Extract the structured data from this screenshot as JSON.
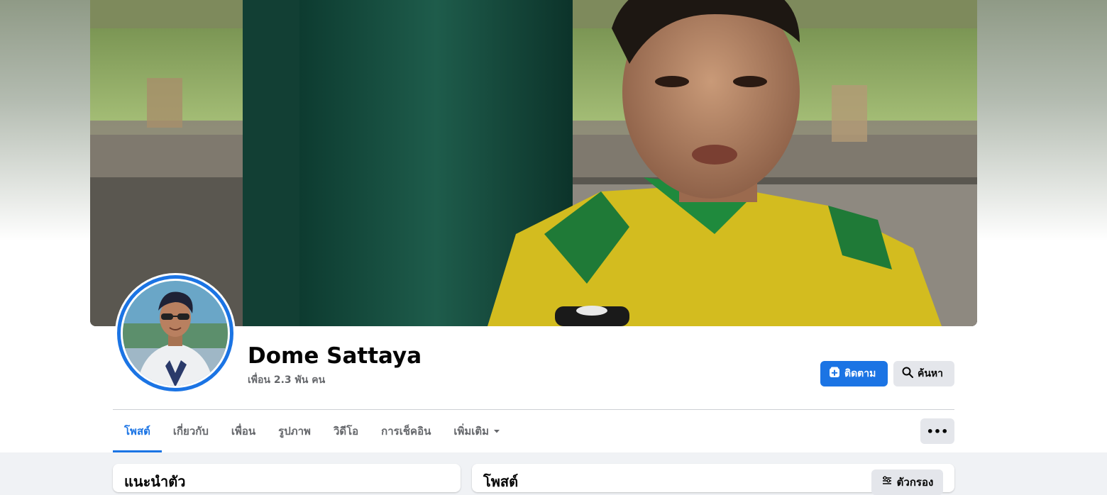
{
  "profile": {
    "name": "Dome Sattaya",
    "friends": "เพื่อน 2.3 พัน คน"
  },
  "actions": {
    "follow_label": "ติดตาม",
    "search_label": "ค้นหา"
  },
  "tabs": [
    {
      "label": "โพสต์",
      "active": true
    },
    {
      "label": "เกี่ยวกับ"
    },
    {
      "label": "เพื่อน"
    },
    {
      "label": "รูปภาพ"
    },
    {
      "label": "วิดีโอ"
    },
    {
      "label": "การเช็คอิน"
    },
    {
      "label": "เพิ่มเติม"
    }
  ],
  "more_button": "•••",
  "sections": {
    "intro_title": "แนะนำตัว",
    "posts_title": "โพสต์",
    "filter_label": "ตัวกรอง"
  },
  "colors": {
    "accent": "#1b74e4",
    "secondary_button": "#e4e6eb",
    "page_background": "#f0f2f5"
  }
}
